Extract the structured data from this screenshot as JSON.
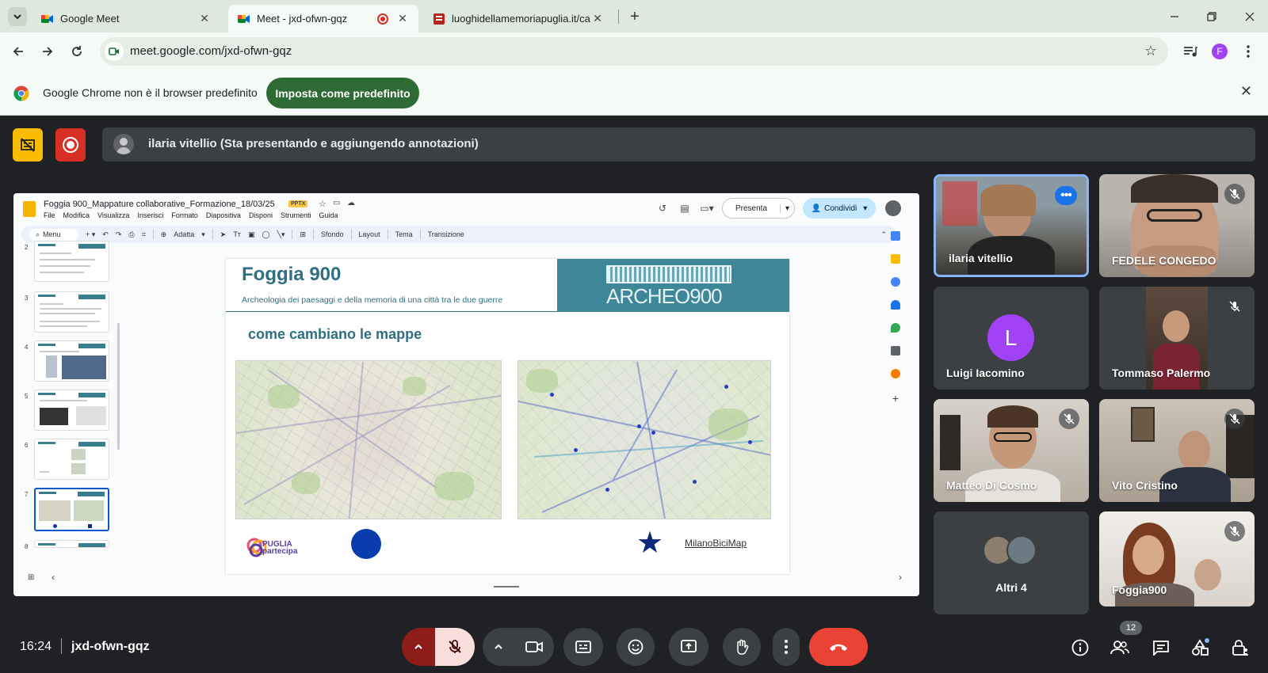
{
  "browser": {
    "tabs": [
      {
        "title": "Google Meet",
        "icon": "meet-icon",
        "active": false
      },
      {
        "title": "Meet - jxd-ofwn-gqz",
        "icon": "meet-icon",
        "active": true,
        "recording": true
      },
      {
        "title": "luoghidellamemoriapuglia.it/ca",
        "icon": "site-icon",
        "active": false
      }
    ],
    "url": "meet.google.com/jxd-ofwn-gqz",
    "profile_initial": "F"
  },
  "infobar": {
    "message": "Google Chrome non è il browser predefinito",
    "button": "Imposta come predefinito"
  },
  "meet": {
    "presenter_status": "ilaria vitellio (Sta presentando e aggiungendo annotazioni)",
    "time": "16:24",
    "meeting_code": "jxd-ofwn-gqz",
    "participant_count": "12",
    "participants": [
      {
        "name": "ilaria vitellio",
        "speaking": true,
        "muted": false
      },
      {
        "name": "FEDELE CONGEDO",
        "muted": true
      },
      {
        "name": "Luigi Iacomino",
        "initial": "L",
        "avatar_color": "#a142f4",
        "muted": false
      },
      {
        "name": "Tommaso Palermo",
        "muted": true
      },
      {
        "name": "Matteo Di Cosmo",
        "muted": true
      },
      {
        "name": "Vito Cristino",
        "muted": true
      },
      {
        "name": "Altri 4",
        "muted": false
      },
      {
        "name": "Foggia900",
        "muted": true
      }
    ]
  },
  "slides_app": {
    "doc_title": "Foggia 900_Mappature collaborative_Formazione_18/03/25",
    "doc_badge": "PPTX",
    "menu": [
      "File",
      "Modifica",
      "Visualizza",
      "Inserisci",
      "Formato",
      "Diapositiva",
      "Disponi",
      "Strumenti",
      "Guida"
    ],
    "present_label": "Presenta",
    "share_label": "Condividi",
    "toolbar": {
      "search": "Menu",
      "zoom": "Adatta",
      "background": "Sfondo",
      "layout": "Layout",
      "theme": "Tema",
      "transition": "Transizione"
    },
    "thumbnails": [
      "2",
      "3",
      "4",
      "5",
      "6",
      "7",
      "8"
    ],
    "selected_thumbnail": "7",
    "slide": {
      "title": "Foggia 900",
      "subtitle": "Archeologia dei paesaggi e della memoria di una città tra le due guerre",
      "logo": "ARCHEO900",
      "heading": "come cambiano le mappe",
      "footer_logo": "PUGLIA partecipa",
      "footer_link": "MilanoBiciMap"
    }
  },
  "colors": {
    "meet_bg": "#202124",
    "tile_bg": "#3c4043",
    "hangup": "#ea4335",
    "mic_off": "#f9dedc",
    "record": "#d93025",
    "slide_teal": "#2f6f81"
  }
}
